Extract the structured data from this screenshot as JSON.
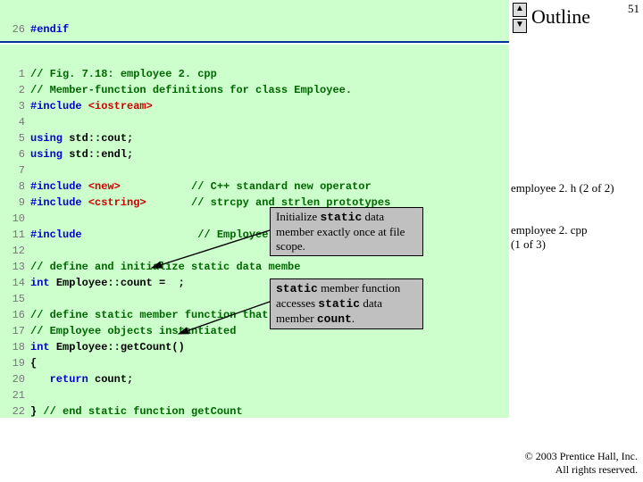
{
  "outline": {
    "title": "Outline",
    "page": "51",
    "label1": "employee 2. h (2 of 2)",
    "label2": "employee 2. cpp",
    "label3": "(1 of 3)"
  },
  "copyright": {
    "line1": "© 2003 Prentice Hall, Inc.",
    "line2": "All rights reserved."
  },
  "topcode": {
    "ln": "26",
    "text": "#endif"
  },
  "code": {
    "l1n": "1",
    "l1": "// Fig. 7.18: employee 2. cpp",
    "l2n": "2",
    "l2": "// Member-function definitions for class Employee.",
    "l3n": "3",
    "l3a": "#include ",
    "l3b": "<iostream>",
    "l4n": "4",
    "l4": "",
    "l5n": "5",
    "l5a": "using ",
    "l5b": "std::cout;",
    "l6n": "6",
    "l6a": "using ",
    "l6b": "std::endl;",
    "l7n": "7",
    "l7": "",
    "l8n": "8",
    "l8a": "#include ",
    "l8b": "<new>",
    "l8c": "           // C++ standard new operator",
    "l9n": "9",
    "l9a": "#include ",
    "l9b": "<cstring>",
    "l9c": "       // strcpy and strlen prototypes",
    "l10n": "10",
    "l10": "",
    "l11n": "11",
    "l11a": "#include ",
    "l11b": "                 // Employee class ",
    "l12n": "12",
    "l12": "",
    "l13n": "13",
    "l13": "// define and initialize static data membe",
    "l14n": "14",
    "l14a": "int ",
    "l14b": "Employee::count =  ;",
    "l15n": "15",
    "l15": "",
    "l16n": "16",
    "l16": "// define static member function that retu",
    "l17n": "17",
    "l17": "// Employee objects instantiated",
    "l18n": "18",
    "l18a": "int ",
    "l18b": "Employee::getCount()",
    "l19n": "19",
    "l19": "{",
    "l20n": "20",
    "l20a": "   return ",
    "l20b": "count;",
    "l21n": "21",
    "l21": "",
    "l22n": "22",
    "l22a": "} ",
    "l22b": "// end static function getCount"
  },
  "callout1": {
    "t1": "Initialize ",
    "t2": "static",
    "t3": " data member exactly once at file scope."
  },
  "callout2": {
    "t1": "static",
    "t2": " member function accesses ",
    "t3": "static",
    "t4": " data member ",
    "t5": "count",
    "t6": "."
  }
}
